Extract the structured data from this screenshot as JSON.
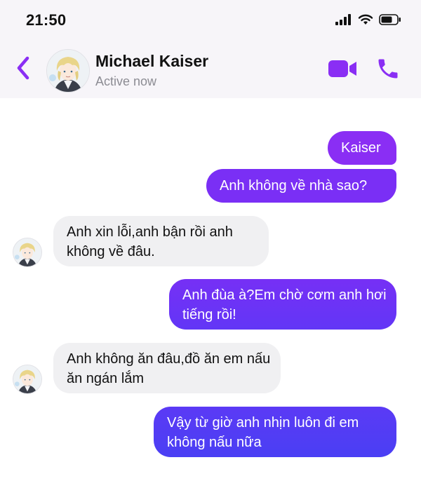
{
  "status_bar": {
    "time": "21:50",
    "icons": [
      "cellular-signal-icon",
      "wifi-icon",
      "battery-icon"
    ]
  },
  "header": {
    "contact_name": "Michael Kaiser",
    "contact_status": "Active now",
    "icons": [
      "back-chevron-icon",
      "video-call-icon",
      "phone-call-icon"
    ],
    "accent_color": "#8a2ef4"
  },
  "messages": [
    {
      "direction": "outgoing",
      "text": "Kaiser"
    },
    {
      "direction": "outgoing",
      "text": "Anh không về nhà sao?"
    },
    {
      "direction": "incoming",
      "text": "Anh xin lỗi,anh bận rồi anh không về đâu."
    },
    {
      "direction": "outgoing",
      "text": "Anh đùa à?Em chờ cơm anh hơi tiếng rồi!"
    },
    {
      "direction": "incoming",
      "text": "Anh không ăn đâu,đồ ăn em nấu ăn ngán lắm"
    },
    {
      "direction": "outgoing",
      "text": "Vậy từ giờ anh nhịn luôn đi em không nấu nữa"
    }
  ],
  "colors": {
    "outgoing_bubble_top": "#8a2ef4",
    "outgoing_bubble_bottom": "#4a3ff4",
    "incoming_bubble": "#f0f0f2",
    "header_background": "#f7f5f9"
  }
}
